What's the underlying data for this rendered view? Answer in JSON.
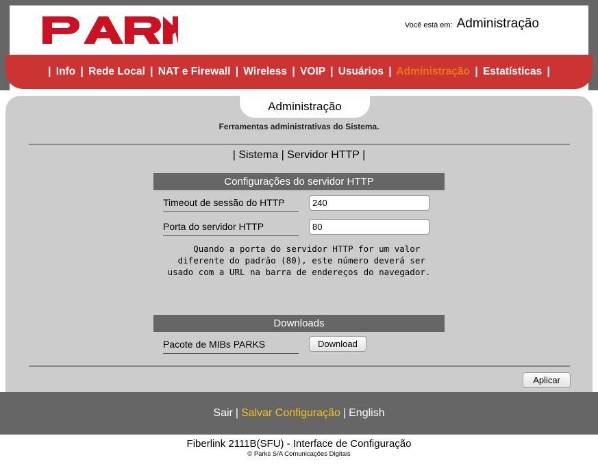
{
  "header": {
    "logo_text": "PARKS",
    "breadcrumb_prefix": "Você está em:",
    "breadcrumb_location": "Administração"
  },
  "nav": {
    "items": [
      {
        "label": "Info",
        "active": false
      },
      {
        "label": "Rede Local",
        "active": false
      },
      {
        "label": "NAT e Firewall",
        "active": false
      },
      {
        "label": "Wireless",
        "active": false
      },
      {
        "label": "VOIP",
        "active": false
      },
      {
        "label": "Usuários",
        "active": false
      },
      {
        "label": "Administração",
        "active": true
      },
      {
        "label": "Estatísticas",
        "active": false
      }
    ],
    "separator": "|",
    "active_color": "#e8790f",
    "bar_color": "#cc3333"
  },
  "panel": {
    "tab_label": "Administração",
    "subtitle": "Ferramentas administrativas do Sistema.",
    "subnav": {
      "separator": "|",
      "items": [
        {
          "label": "Sistema"
        },
        {
          "label": "Servidor HTTP"
        }
      ]
    }
  },
  "http_section": {
    "title": "Configurações do servidor HTTP",
    "fields": [
      {
        "label": "Timeout de sessão do HTTP",
        "value": "240"
      },
      {
        "label": "Porta do servidor HTTP",
        "value": "80"
      }
    ],
    "help_text": "   Quando a porta do servidor HTTP for um valor\n diferente do padrão (80), este número deverá ser\nusado com a URL na barra de endereços do navegador."
  },
  "downloads_section": {
    "title": "Downloads",
    "item_label": "Pacote de MIBs PARKS",
    "button_label": "Download"
  },
  "actions": {
    "apply_label": "Aplicar"
  },
  "footer": {
    "links": [
      {
        "label": "Sair",
        "highlight": false
      },
      {
        "label": "Salvar Configuração",
        "highlight": true
      },
      {
        "label": "English",
        "highlight": false
      }
    ],
    "separator": "|",
    "highlight_color": "#f5c518",
    "bar_color": "#666666"
  },
  "credits": {
    "model": "Fiberlink 2111B(SFU) - Interface de Configuração",
    "copyright": "© Parks S/A Comunicações Digitais"
  }
}
